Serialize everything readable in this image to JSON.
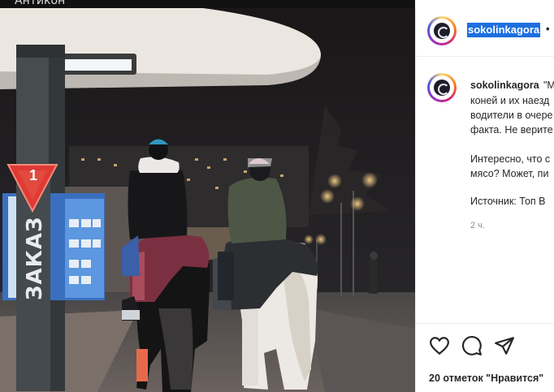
{
  "overlay_title": "Антикон",
  "photo": {
    "sign_number": "1",
    "sign_text": "ЗАКАЗ",
    "colors": {
      "sky": "#1b1a1c",
      "canopy": "#e8e4dd",
      "sign_red": "#e03a35"
    }
  },
  "post": {
    "username": "sokolinkagora",
    "dot": "•",
    "caption_quote": "\"М",
    "caption_lines": [
      "коней и их наезд",
      "водители в очере",
      "факта. Не верите",
      "",
      "Интересно, что с",
      "мясо? Может, пи",
      "",
      "Источник: Топ В"
    ],
    "time": "2 ч.",
    "likes": "20 отметок \"Нравится\""
  },
  "icons": [
    "heart-icon",
    "comment-icon",
    "share-icon"
  ]
}
